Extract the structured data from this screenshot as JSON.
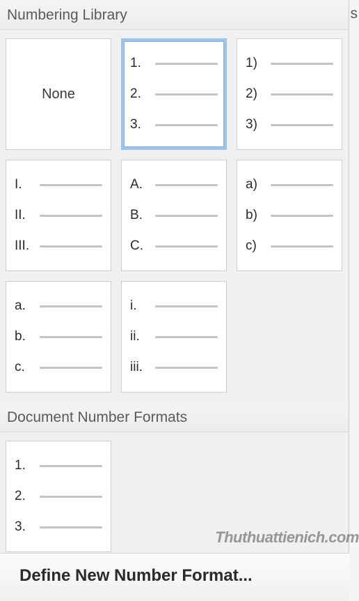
{
  "sections": {
    "library_title": "Numbering Library",
    "document_title": "Document Number Formats"
  },
  "library_tiles": [
    {
      "type": "none",
      "label": "None",
      "selected": false
    },
    {
      "type": "list",
      "markers": [
        "1.",
        "2.",
        "3."
      ],
      "selected": true
    },
    {
      "type": "list",
      "markers": [
        "1)",
        "2)",
        "3)"
      ],
      "selected": false
    },
    {
      "type": "list",
      "markers": [
        "I.",
        "II.",
        "III."
      ],
      "selected": false
    },
    {
      "type": "list",
      "markers": [
        "A.",
        "B.",
        "C."
      ],
      "selected": false
    },
    {
      "type": "list",
      "markers": [
        "a)",
        "b)",
        "c)"
      ],
      "selected": false
    },
    {
      "type": "list",
      "markers": [
        "a.",
        "b.",
        "c."
      ],
      "selected": false
    },
    {
      "type": "list",
      "markers": [
        "i.",
        "ii.",
        "iii."
      ],
      "selected": false
    }
  ],
  "document_tiles": [
    {
      "type": "list",
      "markers": [
        "1.",
        "2.",
        "3."
      ],
      "selected": false
    }
  ],
  "footer": {
    "define_label": "Define New Number Format..."
  },
  "watermark": "Thuthuattienich.com",
  "extra_letter": "s"
}
